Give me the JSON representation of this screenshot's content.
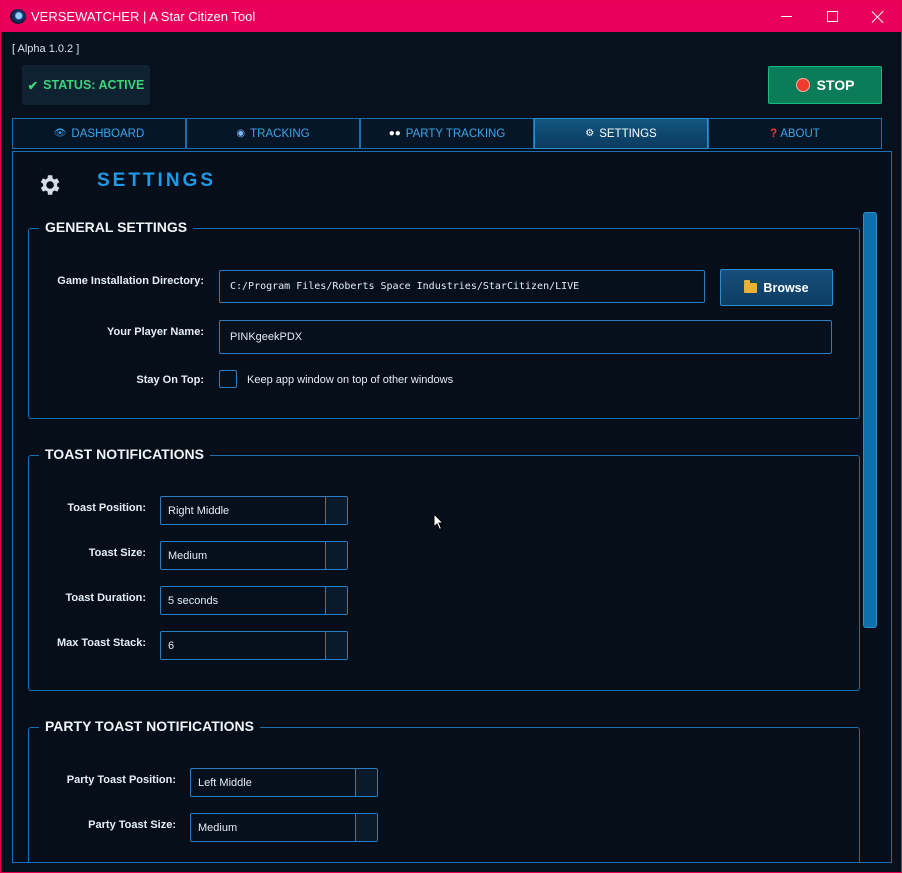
{
  "window": {
    "title": "VERSEWATCHER | A Star Citizen Tool"
  },
  "app": {
    "version": "[ Alpha 1.0.2 ]",
    "status": "STATUS: ACTIVE",
    "stop_label": "STOP"
  },
  "tabs": [
    {
      "label": "DASHBOARD",
      "icon": "eye-icon"
    },
    {
      "label": "TRACKING",
      "icon": "target-icon"
    },
    {
      "label": "PARTY TRACKING",
      "icon": "eyes-icon"
    },
    {
      "label": "SETTINGS",
      "icon": "gear-icon",
      "active": true
    },
    {
      "label": "ABOUT",
      "icon": "question-icon"
    }
  ],
  "settings": {
    "title": "SETTINGS",
    "general": {
      "title": "GENERAL SETTINGS",
      "install_label": "Game Installation Directory:",
      "install_value": "C:/Program Files/Roberts Space Industries/StarCitizen/LIVE",
      "browse_label": "Browse",
      "player_label": "Your Player Name:",
      "player_value": "PINKgeekPDX",
      "ontop_label": "Stay On Top:",
      "ontop_text": "Keep app window on top of other windows",
      "ontop_checked": false
    },
    "toast": {
      "title": "TOAST NOTIFICATIONS",
      "position_label": "Toast Position:",
      "position_value": "Right Middle",
      "size_label": "Toast Size:",
      "size_value": "Medium",
      "duration_label": "Toast Duration:",
      "duration_value": "5 seconds",
      "stack_label": "Max Toast Stack:",
      "stack_value": "6"
    },
    "party": {
      "title": "PARTY TOAST NOTIFICATIONS",
      "position_label": "Party Toast Position:",
      "position_value": "Left Middle",
      "size_label": "Party Toast Size:",
      "size_value": "Medium"
    }
  },
  "colors": {
    "titlebar": "#e8005a",
    "accent": "#1f9ae8",
    "status": "#3fd37a",
    "stop": "#0a7d58"
  }
}
